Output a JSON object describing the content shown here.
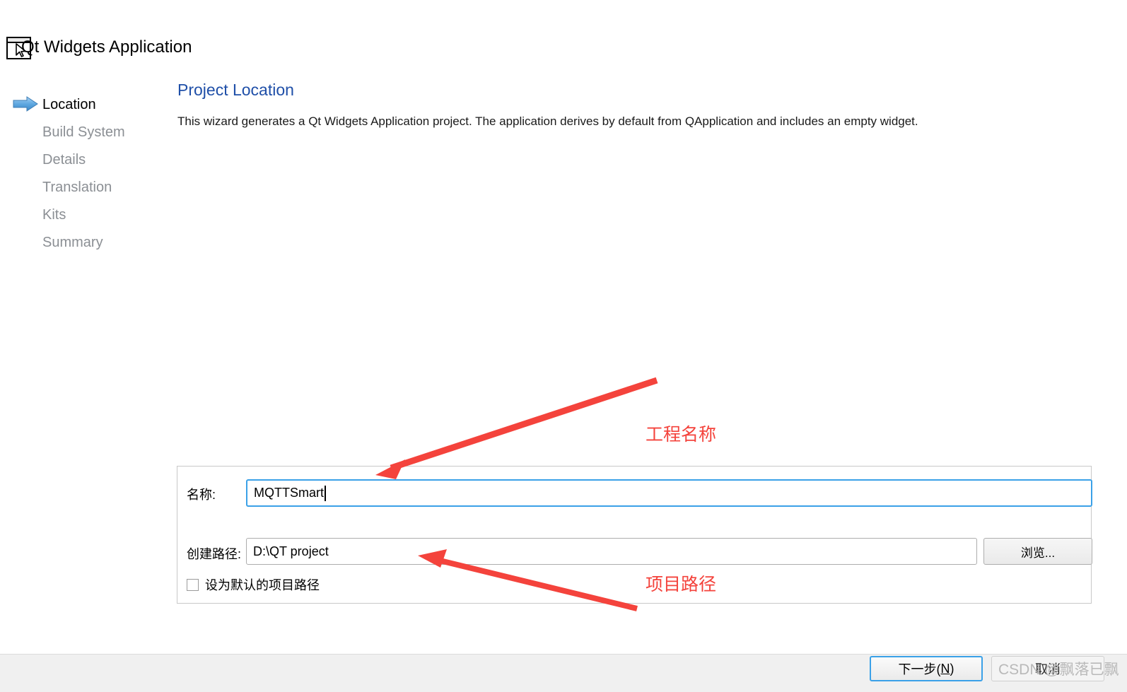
{
  "window": {
    "title": "Qt Widgets Application",
    "icon": "window-cursor-icon"
  },
  "sidebar": {
    "active_index": 0,
    "arrow_icon": "blue-arrow-icon",
    "items": [
      {
        "label": "Location"
      },
      {
        "label": "Build System"
      },
      {
        "label": "Details"
      },
      {
        "label": "Translation"
      },
      {
        "label": "Kits"
      },
      {
        "label": "Summary"
      }
    ]
  },
  "page": {
    "title": "Project Location",
    "description": "This wizard generates a Qt Widgets Application project. The application derives by default from QApplication and includes an empty widget."
  },
  "form": {
    "name_label": "名称:",
    "name_value": "MQTTSmart",
    "path_label": "创建路径:",
    "path_value": "D:\\QT project",
    "browse_label": "浏览...",
    "default_path_label": "设为默认的项目路径",
    "default_path_checked": false
  },
  "annotations": [
    {
      "text": "工程名称",
      "color": "#f4433c",
      "arrow": "arrow-to-name-field"
    },
    {
      "text": "项目路径",
      "color": "#f4433c",
      "arrow": "arrow-to-path-field"
    }
  ],
  "footer": {
    "next_label_prefix": "下一步(",
    "next_mnemonic": "N",
    "next_label_suffix": ")",
    "cancel_label": "取消",
    "watermark": "CSDN @飘落已飘"
  },
  "colors": {
    "accent_blue": "#1f4fa8",
    "focus_blue": "#3ba1e8",
    "annotation_red": "#f4433c",
    "muted_step": "#8b8f94",
    "footer_bg": "#f0f0f0"
  }
}
